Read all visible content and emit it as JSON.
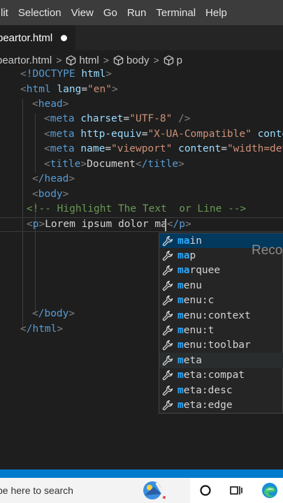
{
  "menu": [
    "lit",
    "Selection",
    "View",
    "Go",
    "Run",
    "Terminal",
    "Help"
  ],
  "tab": {
    "label": "peartor.html"
  },
  "breadcrumb": {
    "file": "peartor.html",
    "items": [
      "html",
      "body",
      "p"
    ]
  },
  "code": {
    "l1_doctype": "!DOCTYPE",
    "l1_html": "html",
    "l2_tag": "html",
    "l2_attr": "lang",
    "l2_val": "\"en\"",
    "l3_tag": "head",
    "l4_tag": "meta",
    "l4_attr": "charset",
    "l4_val": "\"UTF-8\"",
    "l4_close": "/>",
    "l5_tag": "meta",
    "l5_attr": "http-equiv",
    "l5_val": "\"X-UA-Compatible\"",
    "l5_attr2": "conte",
    "l6_tag": "meta",
    "l6_attr": "name",
    "l6_val": "\"viewport\"",
    "l6_attr2": "content",
    "l6_val2": "\"width=dev",
    "l7_tag": "title",
    "l7_text": "Document",
    "l7_close": "/title",
    "l8_tag": "/head",
    "l9_tag": "body",
    "l10_comment": "<!-- Highlight The Text  or Line -->",
    "l11_tag": "p",
    "l11_text": "Lorem ipsum dolor ma",
    "l11_close": "/p",
    "l12_tag": "/body",
    "l13_tag": "/html"
  },
  "suggestions": [
    {
      "match": "ma",
      "rest": "in"
    },
    {
      "match": "ma",
      "rest": "p"
    },
    {
      "match": "ma",
      "rest": "rquee"
    },
    {
      "match": "m",
      "rest": "enu"
    },
    {
      "match": "m",
      "rest": "enu:c"
    },
    {
      "match": "m",
      "rest": "enu:context"
    },
    {
      "match": "m",
      "rest": "enu:t"
    },
    {
      "match": "m",
      "rest": "enu:toolbar"
    },
    {
      "match": "m",
      "rest": "eta"
    },
    {
      "match": "m",
      "rest": "eta:compat"
    },
    {
      "match": "m",
      "rest": "eta:desc"
    },
    {
      "match": "m",
      "rest": "eta:edge"
    }
  ],
  "suggest_read_more": "Reco",
  "taskbar": {
    "search_placeholder": "pe here to search"
  },
  "colors": {
    "statusbar": "#007acc",
    "tag": "#569cd6",
    "attribute": "#9cdcfe",
    "string": "#ce9178",
    "comment": "#6a9955",
    "match": "#2aaaff"
  },
  "icons": [
    "dirty-dot-icon",
    "cube-icon",
    "wrench-icon",
    "search-highlight-icon",
    "cortana-icon",
    "task-view-icon",
    "edge-browser-icon"
  ]
}
